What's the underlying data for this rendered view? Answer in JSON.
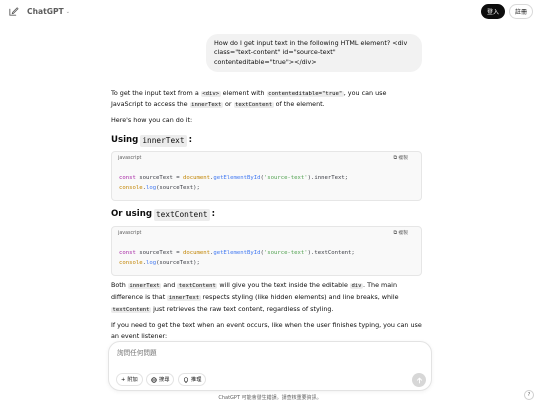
{
  "header": {
    "brand": "ChatGPT",
    "login_label": "登入",
    "signup_label": "註冊"
  },
  "user_message": "How do I get input text in the following HTML element? <div class=\"text-content\" id=\"source-text\" contenteditable=\"true\"></div>",
  "response": {
    "intro_1": "To get the input text from a ",
    "intro_code_1": "<div>",
    "intro_2": " element with ",
    "intro_code_2": "contenteditable=\"true\"",
    "intro_3": ", you can use",
    "intro_4": "JavaScript to access the ",
    "intro_code_3": "innerText",
    "intro_5": " or ",
    "intro_code_4": "textContent",
    "intro_6": " of the element.",
    "howto": "Here's how you can do it:",
    "section1_prefix": "Using",
    "section1_code": "innerText",
    "section1_suffix": ":",
    "section2_prefix": "Or using",
    "section2_code": "textContent",
    "section2_suffix": ":",
    "code_lang": "javascript",
    "copy_label": "複製",
    "code1": {
      "l1_kw": "const",
      "l1_a": " sourceText = ",
      "l1_obj": "document",
      "l1_b": ".",
      "l1_fn": "getElementById",
      "l1_c": "(",
      "l1_str": "'source-text'",
      "l1_d": ").innerText;",
      "l2_obj": "console",
      "l2_a": ".",
      "l2_fn": "log",
      "l2_b": "(sourceText);"
    },
    "code2": {
      "l1_kw": "const",
      "l1_a": " sourceText = ",
      "l1_obj": "document",
      "l1_b": ".",
      "l1_fn": "getElementById",
      "l1_c": "(",
      "l1_str": "'source-text'",
      "l1_d": ").textContent;",
      "l2_obj": "console",
      "l2_a": ".",
      "l2_fn": "log",
      "l2_b": "(sourceText);"
    },
    "both_1": "Both ",
    "both_code_1": "innerText",
    "both_2": " and ",
    "both_code_2": "textContent",
    "both_3": " will give you the text inside the editable ",
    "both_code_3": "div",
    "both_4": ". The main",
    "both_5": "difference is that ",
    "both_code_4": "innerText",
    "both_6": " respects styling (like hidden elements) and line breaks, while",
    "both_code_5": "textContent",
    "both_7": " just retrieves the raw text content, regardless of styling.",
    "event_1": "If you need to get the text when an event occurs, like when the user finishes typing, you can use",
    "event_2": "an event listener:"
  },
  "composer": {
    "placeholder": "詢問任何問題",
    "attach_label": "附加",
    "search_label": "搜尋",
    "reason_label": "推理"
  },
  "footer": {
    "disclaimer": "ChatGPT 可能會發生錯誤。請查核重要資訊。",
    "help_label": "?"
  }
}
